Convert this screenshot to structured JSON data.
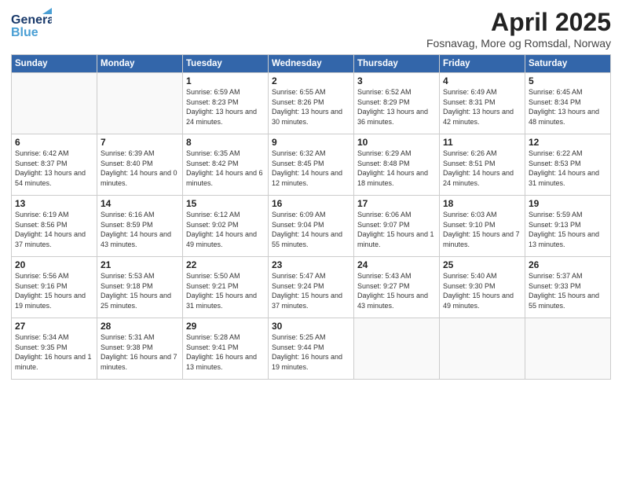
{
  "header": {
    "logo_line1": "General",
    "logo_line2": "Blue",
    "title": "April 2025",
    "subtitle": "Fosnavag, More og Romsdal, Norway"
  },
  "calendar": {
    "headers": [
      "Sunday",
      "Monday",
      "Tuesday",
      "Wednesday",
      "Thursday",
      "Friday",
      "Saturday"
    ],
    "rows": [
      [
        {
          "day": "",
          "empty": true
        },
        {
          "day": "",
          "empty": true
        },
        {
          "day": "1",
          "sunrise": "6:59 AM",
          "sunset": "8:23 PM",
          "daylight": "13 hours and 24 minutes."
        },
        {
          "day": "2",
          "sunrise": "6:55 AM",
          "sunset": "8:26 PM",
          "daylight": "13 hours and 30 minutes."
        },
        {
          "day": "3",
          "sunrise": "6:52 AM",
          "sunset": "8:29 PM",
          "daylight": "13 hours and 36 minutes."
        },
        {
          "day": "4",
          "sunrise": "6:49 AM",
          "sunset": "8:31 PM",
          "daylight": "13 hours and 42 minutes."
        },
        {
          "day": "5",
          "sunrise": "6:45 AM",
          "sunset": "8:34 PM",
          "daylight": "13 hours and 48 minutes."
        }
      ],
      [
        {
          "day": "6",
          "sunrise": "6:42 AM",
          "sunset": "8:37 PM",
          "daylight": "13 hours and 54 minutes."
        },
        {
          "day": "7",
          "sunrise": "6:39 AM",
          "sunset": "8:40 PM",
          "daylight": "14 hours and 0 minutes."
        },
        {
          "day": "8",
          "sunrise": "6:35 AM",
          "sunset": "8:42 PM",
          "daylight": "14 hours and 6 minutes."
        },
        {
          "day": "9",
          "sunrise": "6:32 AM",
          "sunset": "8:45 PM",
          "daylight": "14 hours and 12 minutes."
        },
        {
          "day": "10",
          "sunrise": "6:29 AM",
          "sunset": "8:48 PM",
          "daylight": "14 hours and 18 minutes."
        },
        {
          "day": "11",
          "sunrise": "6:26 AM",
          "sunset": "8:51 PM",
          "daylight": "14 hours and 24 minutes."
        },
        {
          "day": "12",
          "sunrise": "6:22 AM",
          "sunset": "8:53 PM",
          "daylight": "14 hours and 31 minutes."
        }
      ],
      [
        {
          "day": "13",
          "sunrise": "6:19 AM",
          "sunset": "8:56 PM",
          "daylight": "14 hours and 37 minutes."
        },
        {
          "day": "14",
          "sunrise": "6:16 AM",
          "sunset": "8:59 PM",
          "daylight": "14 hours and 43 minutes."
        },
        {
          "day": "15",
          "sunrise": "6:12 AM",
          "sunset": "9:02 PM",
          "daylight": "14 hours and 49 minutes."
        },
        {
          "day": "16",
          "sunrise": "6:09 AM",
          "sunset": "9:04 PM",
          "daylight": "14 hours and 55 minutes."
        },
        {
          "day": "17",
          "sunrise": "6:06 AM",
          "sunset": "9:07 PM",
          "daylight": "15 hours and 1 minute."
        },
        {
          "day": "18",
          "sunrise": "6:03 AM",
          "sunset": "9:10 PM",
          "daylight": "15 hours and 7 minutes."
        },
        {
          "day": "19",
          "sunrise": "5:59 AM",
          "sunset": "9:13 PM",
          "daylight": "15 hours and 13 minutes."
        }
      ],
      [
        {
          "day": "20",
          "sunrise": "5:56 AM",
          "sunset": "9:16 PM",
          "daylight": "15 hours and 19 minutes."
        },
        {
          "day": "21",
          "sunrise": "5:53 AM",
          "sunset": "9:18 PM",
          "daylight": "15 hours and 25 minutes."
        },
        {
          "day": "22",
          "sunrise": "5:50 AM",
          "sunset": "9:21 PM",
          "daylight": "15 hours and 31 minutes."
        },
        {
          "day": "23",
          "sunrise": "5:47 AM",
          "sunset": "9:24 PM",
          "daylight": "15 hours and 37 minutes."
        },
        {
          "day": "24",
          "sunrise": "5:43 AM",
          "sunset": "9:27 PM",
          "daylight": "15 hours and 43 minutes."
        },
        {
          "day": "25",
          "sunrise": "5:40 AM",
          "sunset": "9:30 PM",
          "daylight": "15 hours and 49 minutes."
        },
        {
          "day": "26",
          "sunrise": "5:37 AM",
          "sunset": "9:33 PM",
          "daylight": "15 hours and 55 minutes."
        }
      ],
      [
        {
          "day": "27",
          "sunrise": "5:34 AM",
          "sunset": "9:35 PM",
          "daylight": "16 hours and 1 minute."
        },
        {
          "day": "28",
          "sunrise": "5:31 AM",
          "sunset": "9:38 PM",
          "daylight": "16 hours and 7 minutes."
        },
        {
          "day": "29",
          "sunrise": "5:28 AM",
          "sunset": "9:41 PM",
          "daylight": "16 hours and 13 minutes."
        },
        {
          "day": "30",
          "sunrise": "5:25 AM",
          "sunset": "9:44 PM",
          "daylight": "16 hours and 19 minutes."
        },
        {
          "day": "",
          "empty": true
        },
        {
          "day": "",
          "empty": true
        },
        {
          "day": "",
          "empty": true
        }
      ]
    ]
  }
}
